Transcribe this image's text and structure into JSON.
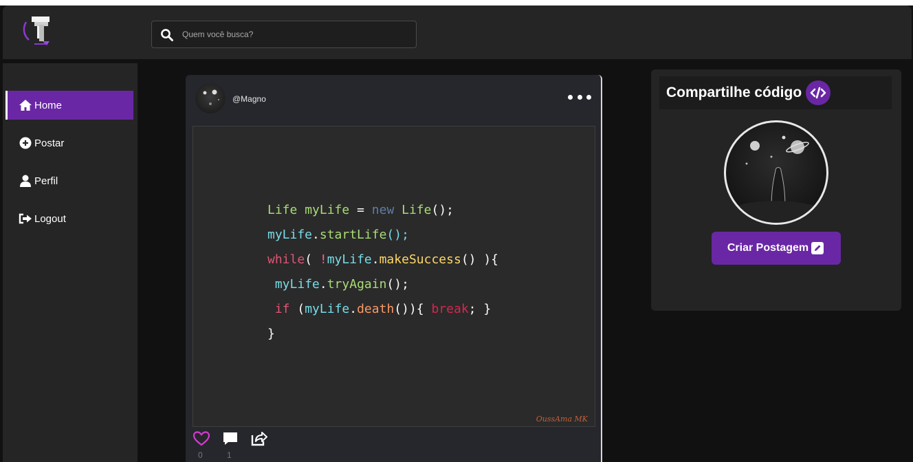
{
  "header": {
    "search_placeholder": "Quem você busca?"
  },
  "sidebar": {
    "items": [
      {
        "label": "Home",
        "icon": "home-icon",
        "active": true
      },
      {
        "label": "Postar",
        "icon": "plus-circle-icon",
        "active": false
      },
      {
        "label": "Perfil",
        "icon": "user-icon",
        "active": false
      },
      {
        "label": "Logout",
        "icon": "logout-icon",
        "active": false
      }
    ]
  },
  "post": {
    "username": "@Magno",
    "code_lines": [
      "Life myLife = new Life();",
      "myLife.startLife();",
      "while( !myLife.makeSuccess() ){",
      " myLife.tryAgain();",
      " if (myLife.death()){ break; }",
      "}"
    ],
    "signature": "OussAma MK",
    "likes": "0",
    "comments": "1"
  },
  "share": {
    "title": "Compartilhe código",
    "button_label": "Criar Postagem"
  },
  "colors": {
    "accent": "#6a27a5",
    "like": "#d63ad0",
    "background": "#111111",
    "panel": "#252525"
  }
}
